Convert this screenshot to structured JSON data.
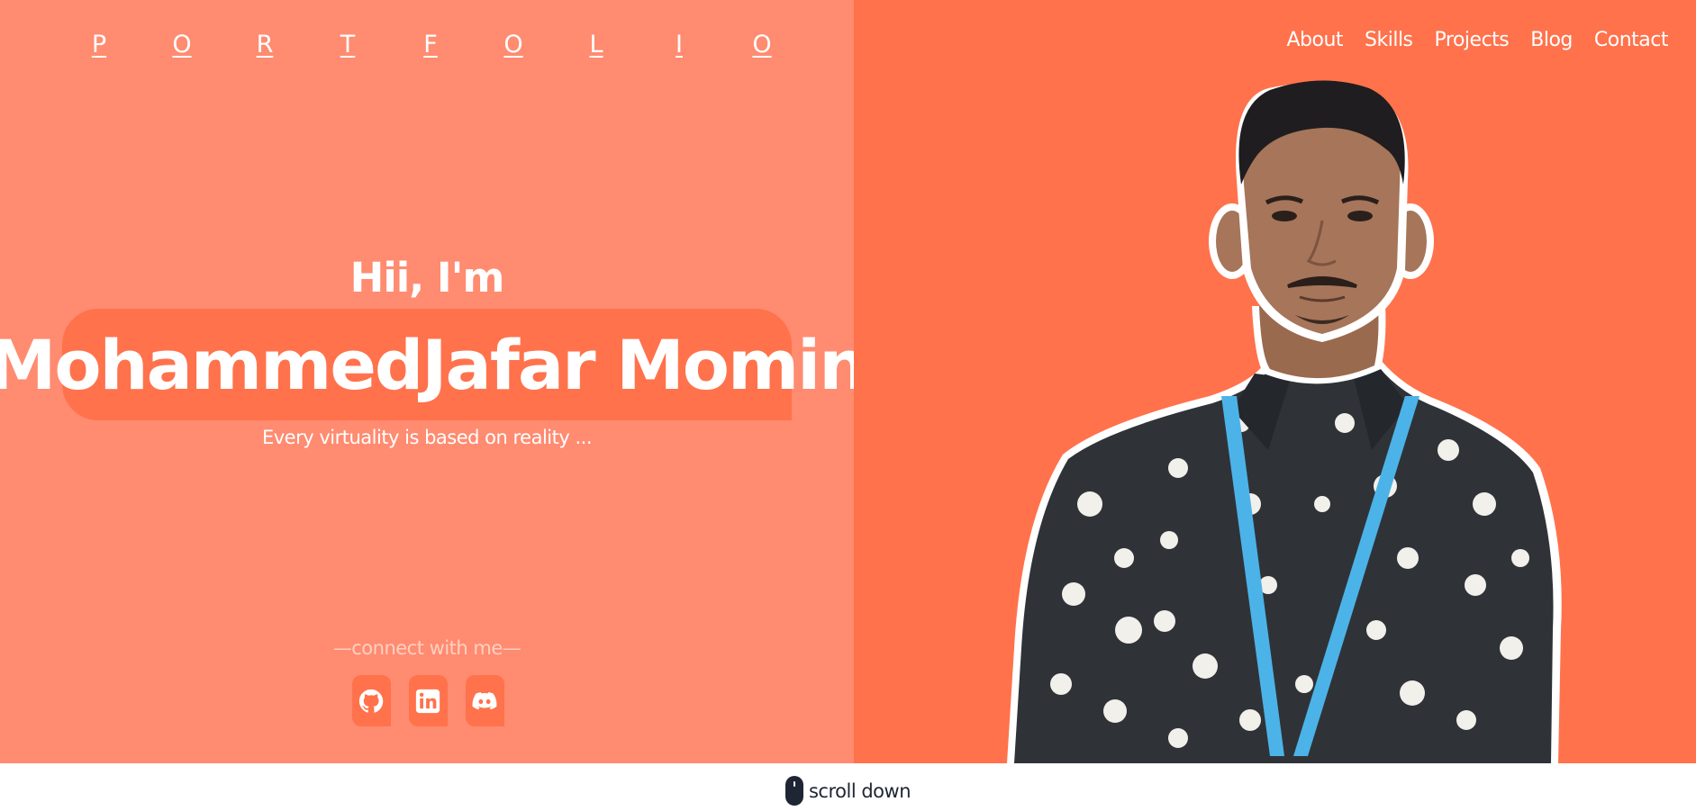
{
  "brand": {
    "letters": [
      "P",
      "O",
      "R",
      "T",
      "F",
      "O",
      "L",
      "I",
      "O"
    ]
  },
  "nav": {
    "items": [
      "About",
      "Skills",
      "Projects",
      "Blog",
      "Contact"
    ]
  },
  "hero": {
    "greeting": "Hii, I'm",
    "name": "MohammedJafar Momin",
    "tagline": "Every virtuality is based on reality ...",
    "connect_label": "—connect with me—",
    "socials": [
      {
        "icon": "github-icon"
      },
      {
        "icon": "linkedin-icon"
      },
      {
        "icon": "discord-icon"
      }
    ]
  },
  "colors": {
    "left_panel": "#ff8b70",
    "right_panel": "#ff724c",
    "accent": "#ff724c",
    "text_light": "#ffffff",
    "footer_text": "#1e2533"
  },
  "footer": {
    "scroll_label": "scroll down"
  }
}
